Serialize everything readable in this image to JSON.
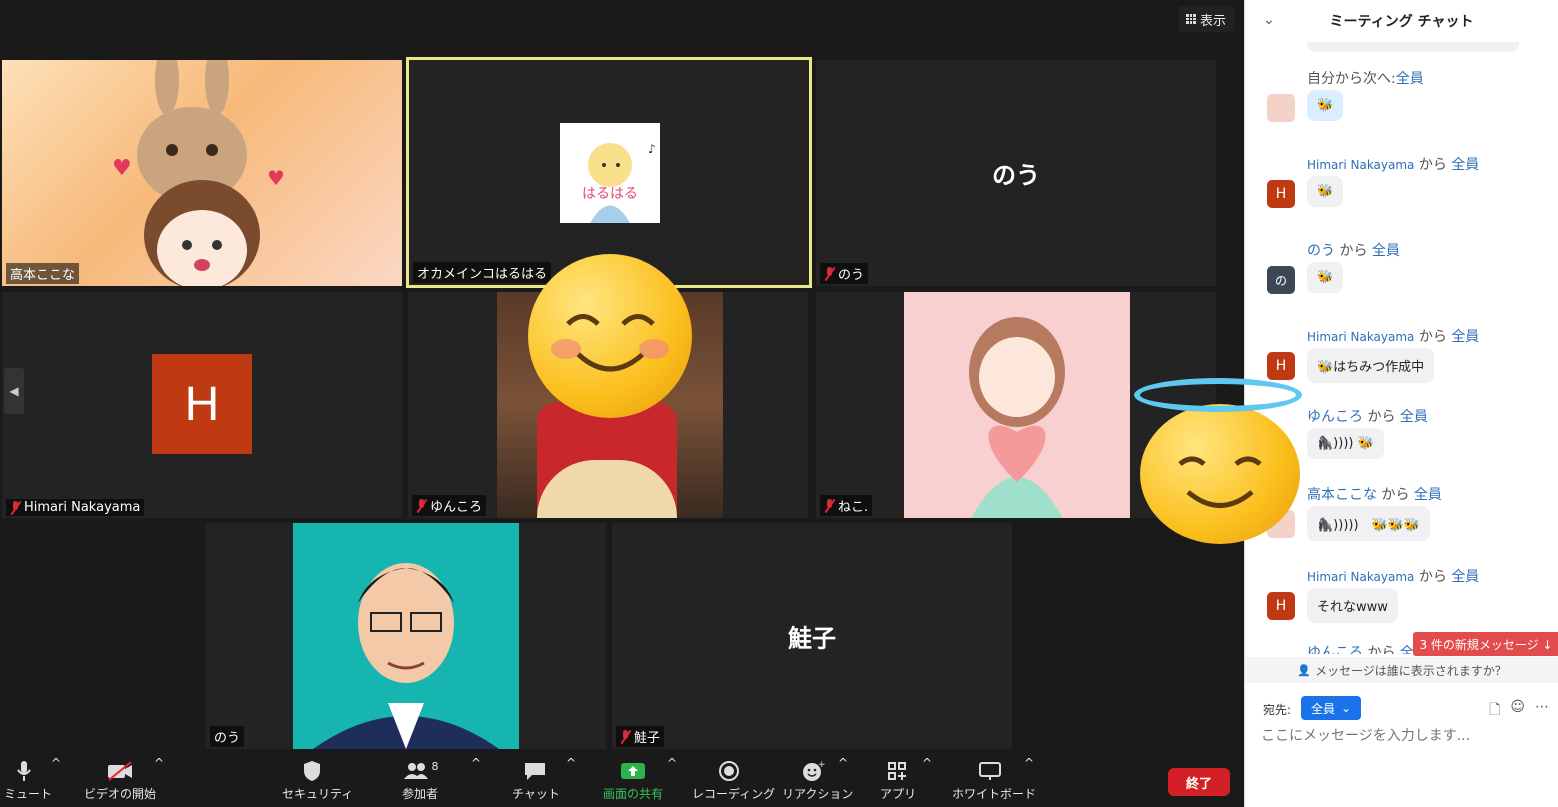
{
  "view_button": {
    "label": "表示"
  },
  "tiles": {
    "t1": {
      "name": "高本ここな"
    },
    "t2": {
      "name": "オカメインコはるはる",
      "image_text": "はるはる"
    },
    "t3": {
      "name": "のう",
      "big": "のう"
    },
    "t4": {
      "name": "Himari Nakayama",
      "avatar": "H"
    },
    "t5": {
      "name": "ゆんころ"
    },
    "t6": {
      "name": "ねこ."
    },
    "t7": {
      "name": "のう"
    },
    "t8": {
      "name": "鮭子",
      "big": "鮭子"
    }
  },
  "toolbar": {
    "mute": "ミュート",
    "video": "ビデオの開始",
    "security": "セキュリティ",
    "participants": "参加者",
    "participants_count": "8",
    "chat": "チャット",
    "share": "画面の共有",
    "record": "レコーディング",
    "reactions": "リアクション",
    "apps": "アプリ",
    "whiteboard": "ホワイトボード",
    "end": "終了"
  },
  "chat": {
    "title": "ミーティング チャット",
    "messages": [
      {
        "meta_prefix": "自分から次へ:",
        "to": "全員",
        "text": "🐝"
      },
      {
        "sender": "Himari Nakayama",
        "from": " から ",
        "to": "全員",
        "text": "🐝",
        "avatar": "H"
      },
      {
        "sender": "のう",
        "from": " から ",
        "to": "全員",
        "text": "🐝",
        "avatar": "の"
      },
      {
        "sender": "Himari Nakayama",
        "from": " から ",
        "to": "全員",
        "text": "🐝はちみつ作成中",
        "avatar": "H"
      },
      {
        "sender": "ゆんころ",
        "from": " から ",
        "to": "全員",
        "text": "🦍)))) 🐝"
      },
      {
        "sender": "高本ここな",
        "from": " から ",
        "to": "全員",
        "text": "🦍)))))　🐝🐝🐝"
      },
      {
        "sender": "Himari Nakayama",
        "from": " から ",
        "to": "全員",
        "text": "それなwww",
        "avatar": "H"
      },
      {
        "sender": "ゆんころ",
        "from": " から ",
        "to": "全員"
      }
    ],
    "new_messages": "3 件の新規メッセージ ↓",
    "visibility_question": "メッセージは誰に表示されますか？",
    "to_label": "宛先:",
    "to_value": "全員",
    "input_placeholder": "ここにメッセージを入力します..."
  }
}
